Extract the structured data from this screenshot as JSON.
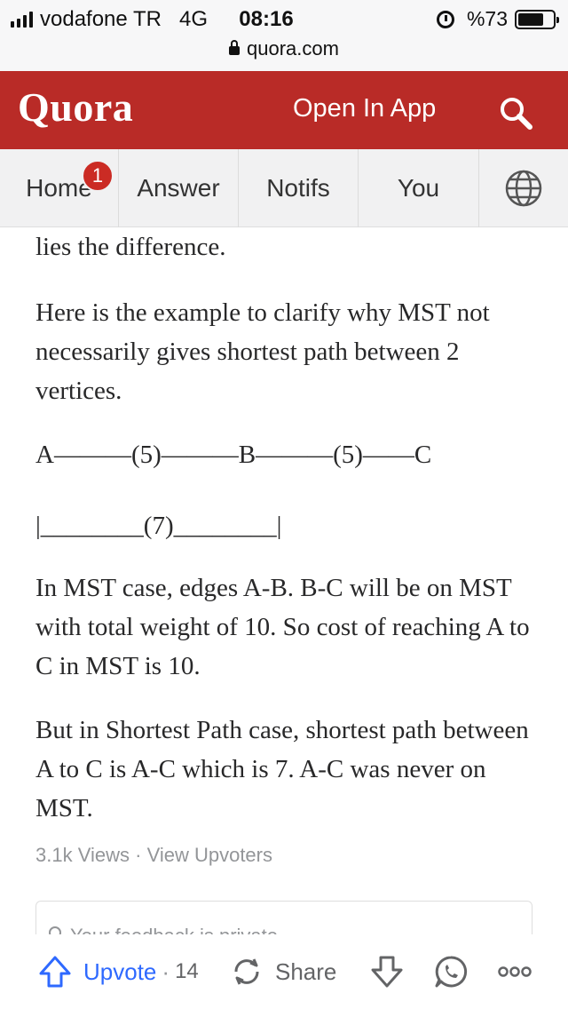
{
  "status_bar": {
    "carrier": "vodafone TR",
    "network": "4G",
    "time": "08:16",
    "battery": "%73",
    "battery_level": 0.73,
    "url": "quora.com"
  },
  "header": {
    "logo": "Quora",
    "open_in_app": "Open In App",
    "search_icon": "search-icon",
    "brand_color": "#b92b27"
  },
  "tabs": [
    {
      "label": "Home",
      "badge": "1"
    },
    {
      "label": "Answer"
    },
    {
      "label": "Notifs"
    },
    {
      "label": "You"
    },
    {
      "label": "",
      "icon": "globe-icon"
    }
  ],
  "content": {
    "paragraphs": [
      "lies the difference.",
      "Here is the example to clarify why MST not necessarily gives shortest path between 2 vertices.",
      "A———(5)———B———(5)——C",
      "|________(7)________|",
      "In MST case, edges A-B. B-C will be on MST with total weight of 10. So cost of reaching A to C in MST is 10.",
      "But in Shortest Path case, shortest path between A to C is A-C which is 7. A-C was never on MST."
    ],
    "views": "3.1k Views",
    "separator": "·",
    "view_upvoters": "View Upvoters",
    "feedback_placeholder": "Your feedback is private"
  },
  "actions": {
    "upvote_label": "Upvote",
    "upvote_count": "14",
    "separator": "·",
    "share_label": "Share",
    "accent_color": "#2e69ff"
  }
}
